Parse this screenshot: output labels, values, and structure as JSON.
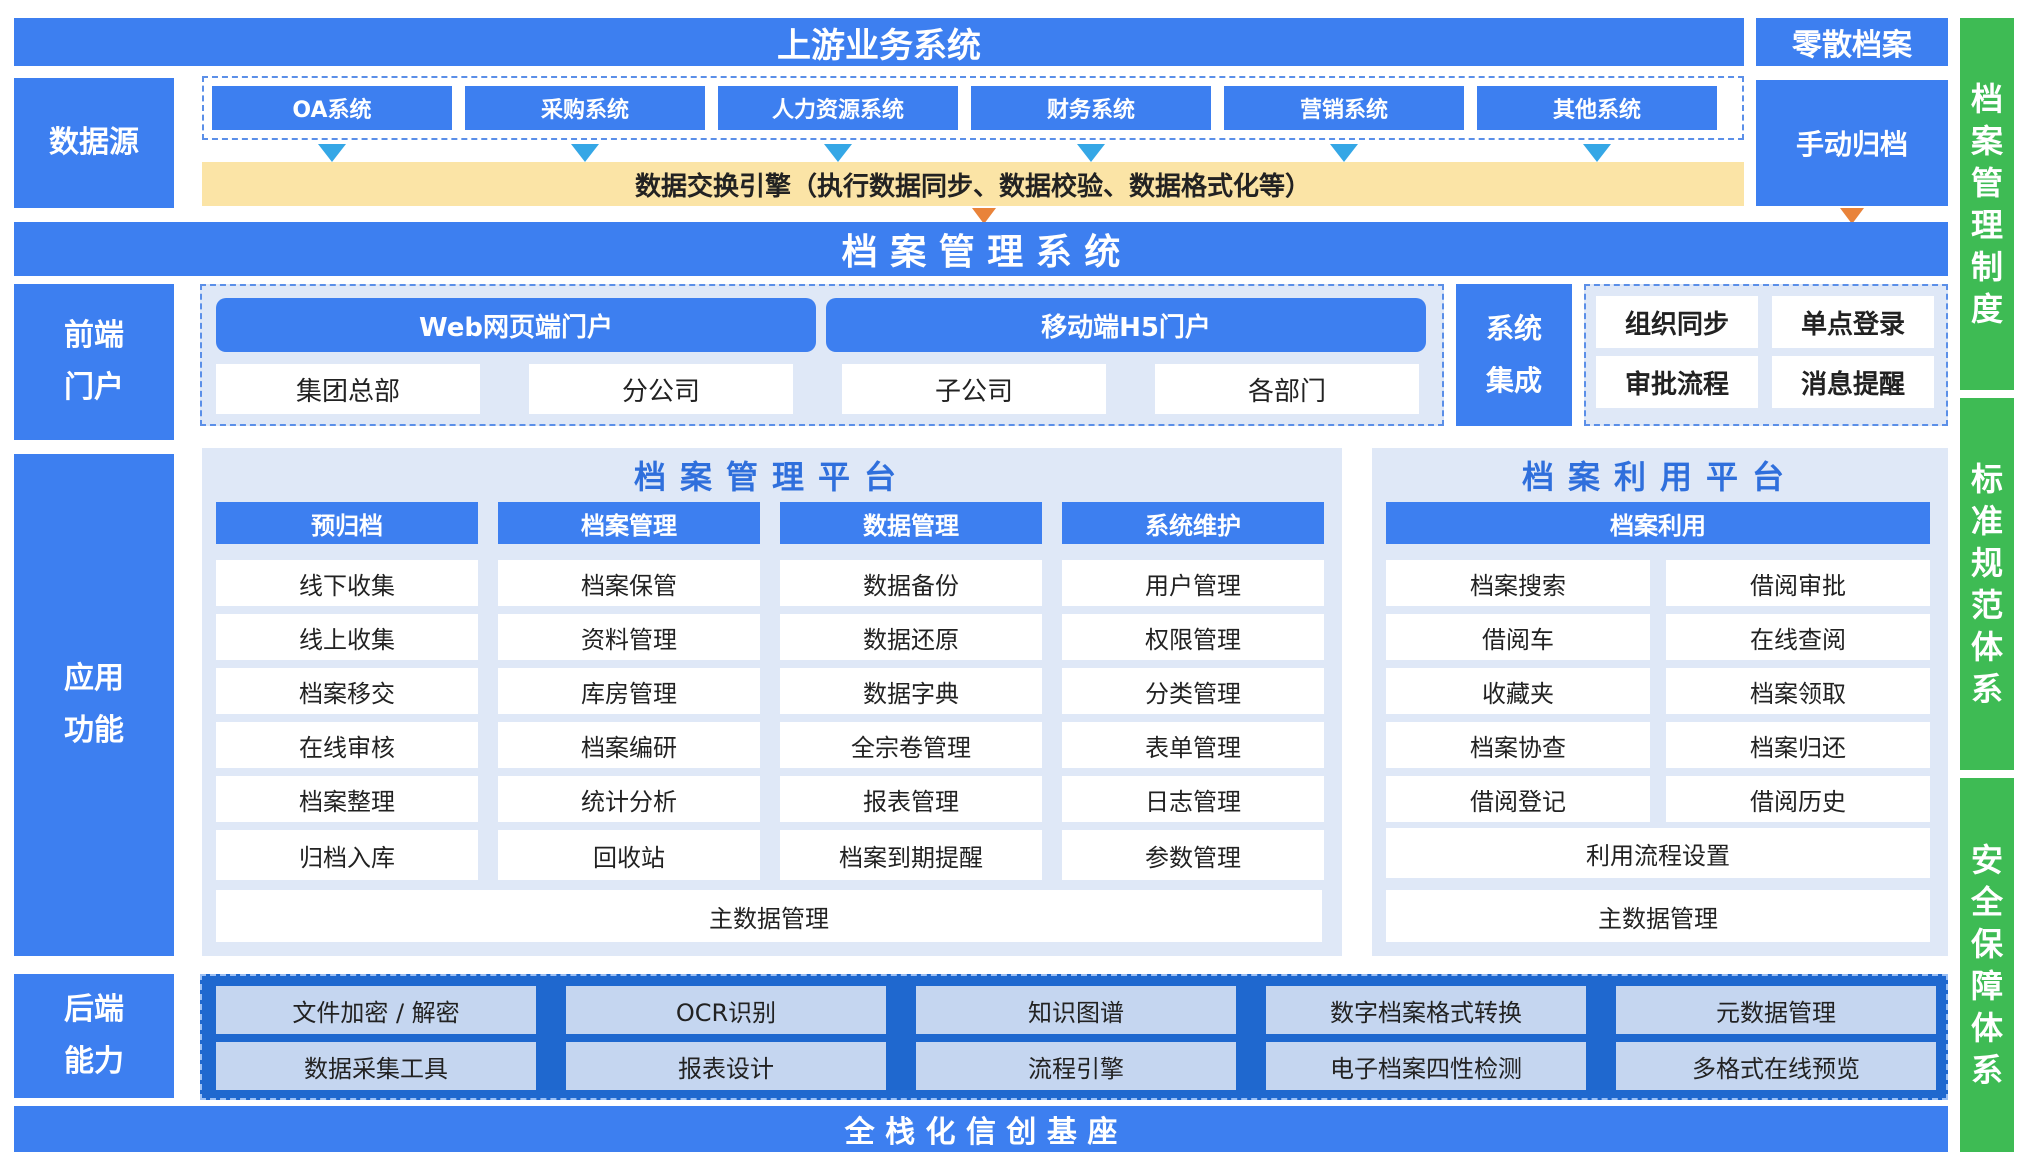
{
  "top": {
    "upstream": "上游业务系统",
    "scattered": "零散档案"
  },
  "datasource": {
    "label": "数据源",
    "systems": [
      "OA系统",
      "采购系统",
      "人力资源系统",
      "财务系统",
      "营销系统",
      "其他系统"
    ],
    "engine": "数据交换引擎（执行数据同步、数据校验、数据格式化等）",
    "manual": "手动归档"
  },
  "archive_system": "档 案 管 理 系 统",
  "frontend": {
    "label_line1": "前端",
    "label_line2": "门户",
    "portals": [
      "Web网页端门户",
      "移动端H5门户"
    ],
    "orgs": [
      "集团总部",
      "分公司",
      "子公司",
      "各部门"
    ],
    "integration_line1": "系统",
    "integration_line2": "集成",
    "integration_items": [
      "组织同步",
      "单点登录",
      "审批流程",
      "消息提醒"
    ]
  },
  "app": {
    "label_line1": "应用",
    "label_line2": "功能",
    "mgmt_platform": {
      "title": "档案管理平台",
      "columns": [
        {
          "head": "预归档",
          "items": [
            "线下收集",
            "线上收集",
            "档案移交",
            "在线审核",
            "档案整理",
            "归档入库"
          ]
        },
        {
          "head": "档案管理",
          "items": [
            "档案保管",
            "资料管理",
            "库房管理",
            "档案编研",
            "统计分析",
            "回收站"
          ]
        },
        {
          "head": "数据管理",
          "items": [
            "数据备份",
            "数据还原",
            "数据字典",
            "全宗卷管理",
            "报表管理",
            "档案到期提醒"
          ]
        },
        {
          "head": "系统维护",
          "items": [
            "用户管理",
            "权限管理",
            "分类管理",
            "表单管理",
            "日志管理",
            "参数管理"
          ]
        }
      ],
      "master_data": "主数据管理"
    },
    "use_platform": {
      "title": "档案利用平台",
      "head": "档案利用",
      "left": [
        "档案搜索",
        "借阅车",
        "收藏夹",
        "档案协查",
        "借阅登记"
      ],
      "right": [
        "借阅审批",
        "在线查阅",
        "档案领取",
        "档案归还",
        "借阅历史"
      ],
      "flow_settings": "利用流程设置",
      "master_data": "主数据管理"
    }
  },
  "backend": {
    "label_line1": "后端",
    "label_line2": "能力",
    "row1": [
      "文件加密 / 解密",
      "OCR识别",
      "知识图谱",
      "数字档案格式转换",
      "元数据管理"
    ],
    "row2": [
      "数据采集工具",
      "报表设计",
      "流程引擎",
      "电子档案四性检测",
      "多格式在线预览"
    ]
  },
  "foundation": "全 栈 化 信 创 基 座",
  "right_side": {
    "archive_policy": [
      "档",
      "案",
      "管",
      "理",
      "制",
      "度"
    ],
    "standards": [
      "标",
      "准",
      "规",
      "范",
      "体",
      "系"
    ],
    "security": [
      "安",
      "全",
      "保",
      "障",
      "体",
      "系"
    ]
  },
  "colors": {
    "blue": "#3d7ff0",
    "green": "#3ebb54",
    "engine_yellow": "#fbe4a6",
    "platform_bg": "#dfe8f7",
    "arrow_blue": "#35a7e6",
    "arrow_orange": "#e9833a"
  }
}
